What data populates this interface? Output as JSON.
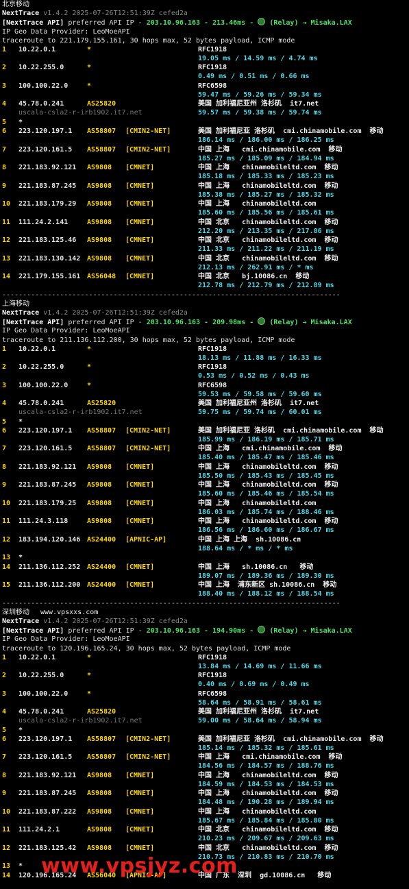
{
  "sections": [
    {
      "title": "北京移动",
      "site": "",
      "header": {
        "brand": "NextTrace",
        "version": "v1.4.2 2025-07-26T12:51:39Z cefed2a",
        "api_tag": "[NextTrace API]",
        "api_text": " preferred API IP - ",
        "api_ip": "203.10.96.163 - 213.46ms - ",
        "api_relay": " (Relay) → Misaka.LAX",
        "geo_provider": "IP Geo Data Provider: LeoMoeAPI",
        "traceroute": "traceroute to 221.179.155.161, 30 hops max, 52 bytes payload, ICMP mode"
      },
      "hops": [
        {
          "num": "1",
          "ip": "10.22.0.1",
          "asn": "*",
          "net": "",
          "geo": "RFC1918",
          "host": "",
          "rtt": "19.05 ms / 14.59 ms / 4.74 ms"
        },
        {
          "num": "2",
          "ip": "10.22.255.0",
          "asn": "*",
          "net": "",
          "geo": "RFC1918",
          "host": "",
          "rtt": "0.49 ms / 0.51 ms / 0.66 ms"
        },
        {
          "num": "3",
          "ip": "100.100.22.0",
          "asn": "*",
          "net": "",
          "geo": "RFC6598",
          "host": "",
          "rtt": "59.47 ms / 59.26 ms / 59.34 ms"
        },
        {
          "num": "4",
          "ip": "45.78.0.241",
          "asn": "AS25820",
          "net": "",
          "geo": "美国 加利福尼亚州 洛杉矶  it7.net",
          "host": "uscala-csla2-r-irb1902.it7.net",
          "rtt": "59.57 ms / 59.38 ms / 59.74 ms"
        },
        {
          "num": "5",
          "ip": "*",
          "asn": "",
          "net": "",
          "geo": "",
          "host": "",
          "rtt": "",
          "star": true
        },
        {
          "num": "6",
          "ip": "223.120.197.1",
          "asn": "AS58807",
          "net": "[CMIN2-NET]",
          "geo": "美国 加利福尼亚 洛杉矶  cmi.chinamobile.com  移动",
          "host": "",
          "rtt": "186.14 ms / 186.00 ms / 186.25 ms"
        },
        {
          "num": "7",
          "ip": "223.120.161.5",
          "asn": "AS58807",
          "net": "[CMIN2-NET]",
          "geo": "中国 上海   cmi.chinamobile.com  移动",
          "host": "",
          "rtt": "185.27 ms / 185.09 ms / 184.94 ms"
        },
        {
          "num": "8",
          "ip": "221.183.92.121",
          "asn": "AS9808",
          "net": "[CMNET]",
          "geo": "中国 上海   chinamobileltd.com  移动",
          "host": "",
          "rtt": "185.18 ms / 185.33 ms / 185.23 ms"
        },
        {
          "num": "9",
          "ip": "221.183.87.245",
          "asn": "AS9808",
          "net": "[CMNET]",
          "geo": "中国 上海   chinamobileltd.com  移动",
          "host": "",
          "rtt": "185.38 ms / 185.27 ms / 185.32 ms"
        },
        {
          "num": "10",
          "ip": "221.183.179.29",
          "asn": "AS9808",
          "net": "[CMNET]",
          "geo": "中国 上海   chinamobileltd.com",
          "host": "",
          "rtt": "185.60 ms / 185.56 ms / 185.61 ms"
        },
        {
          "num": "11",
          "ip": "111.24.2.141",
          "asn": "AS9808",
          "net": "[CMNET]",
          "geo": "中国 北京   chinamobileltd.com  移动",
          "host": "",
          "rtt": "212.20 ms / 213.35 ms / 217.86 ms"
        },
        {
          "num": "12",
          "ip": "221.183.125.46",
          "asn": "AS9808",
          "net": "[CMNET]",
          "geo": "中国 北京   chinamobileltd.com  移动",
          "host": "",
          "rtt": "211.33 ms / 211.22 ms / 211.19 ms"
        },
        {
          "num": "13",
          "ip": "221.183.130.142",
          "asn": "AS9808",
          "net": "[CMNET]",
          "geo": "中国 北京   chinamobileltd.com  移动",
          "host": "",
          "rtt": "212.13 ms / 262.91 ms / * ms"
        },
        {
          "num": "14",
          "ip": "221.179.155.161",
          "asn": "AS56048",
          "net": "[CMNET]",
          "geo": "中国 北京   bj.10086.cn  移动",
          "host": "",
          "rtt": "212.78 ms / 212.79 ms / 212.89 ms"
        }
      ]
    },
    {
      "title": "上海移动",
      "site": "",
      "header": {
        "brand": "NextTrace",
        "version": "v1.4.2 2025-07-26T12:51:39Z cefed2a",
        "api_tag": "[NextTrace API]",
        "api_text": " preferred API IP - ",
        "api_ip": "203.10.96.163 - 209.98ms - ",
        "api_relay": " (Relay) → Misaka.LAX",
        "geo_provider": "IP Geo Data Provider: LeoMoeAPI",
        "traceroute": "traceroute to 211.136.112.200, 30 hops max, 52 bytes payload, ICMP mode"
      },
      "hops": [
        {
          "num": "1",
          "ip": "10.22.0.1",
          "asn": "*",
          "net": "",
          "geo": "RFC1918",
          "host": "",
          "rtt": "18.13 ms / 11.88 ms / 16.33 ms"
        },
        {
          "num": "2",
          "ip": "10.22.255.0",
          "asn": "*",
          "net": "",
          "geo": "RFC1918",
          "host": "",
          "rtt": "0.53 ms / 0.52 ms / 0.43 ms"
        },
        {
          "num": "3",
          "ip": "100.100.22.0",
          "asn": "*",
          "net": "",
          "geo": "RFC6598",
          "host": "",
          "rtt": "59.53 ms / 59.58 ms / 59.60 ms"
        },
        {
          "num": "4",
          "ip": "45.78.0.241",
          "asn": "AS25820",
          "net": "",
          "geo": "美国 加利福尼亚州 洛杉矶  it7.net",
          "host": "uscala-csla2-r-irb1902.it7.net",
          "rtt": "59.75 ms / 59.74 ms / 60.01 ms"
        },
        {
          "num": "5",
          "ip": "*",
          "asn": "",
          "net": "",
          "geo": "",
          "host": "",
          "rtt": "",
          "star": true
        },
        {
          "num": "6",
          "ip": "223.120.197.1",
          "asn": "AS58807",
          "net": "[CMIN2-NET]",
          "geo": "美国 加利福尼亚 洛杉矶  cmi.chinamobile.com  移动",
          "host": "",
          "rtt": "185.99 ms / 186.19 ms / 185.71 ms"
        },
        {
          "num": "7",
          "ip": "223.120.161.5",
          "asn": "AS58807",
          "net": "[CMIN2-NET]",
          "geo": "中国 上海   cmi.chinamobile.com  移动",
          "host": "",
          "rtt": "185.40 ms / 185.47 ms / 185.46 ms"
        },
        {
          "num": "8",
          "ip": "221.183.92.121",
          "asn": "AS9808",
          "net": "[CMNET]",
          "geo": "中国 上海   chinamobileltd.com  移动",
          "host": "",
          "rtt": "185.50 ms / 185.43 ms / 185.45 ms"
        },
        {
          "num": "9",
          "ip": "221.183.87.245",
          "asn": "AS9808",
          "net": "[CMNET]",
          "geo": "中国 上海   chinamobileltd.com  移动",
          "host": "",
          "rtt": "185.60 ms / 185.46 ms / 185.54 ms"
        },
        {
          "num": "10",
          "ip": "221.183.179.25",
          "asn": "AS9808",
          "net": "[CMNET]",
          "geo": "中国 上海   chinamobileltd.com",
          "host": "",
          "rtt": "186.03 ms / 185.74 ms / 188.46 ms"
        },
        {
          "num": "11",
          "ip": "111.24.3.118",
          "asn": "AS9808",
          "net": "[CMNET]",
          "geo": "中国 上海   chinamobileltd.com  移动",
          "host": "",
          "rtt": "186.56 ms / 186.60 ms / 186.67 ms"
        },
        {
          "num": "12",
          "ip": "183.194.120.146",
          "asn": "AS24400",
          "net": "[APNIC-AP]",
          "geo": "中国 上海 上海  sh.10086.cn",
          "host": "",
          "rtt": "188.64 ms / * ms / * ms"
        },
        {
          "num": "13",
          "ip": "*",
          "asn": "",
          "net": "",
          "geo": "",
          "host": "",
          "rtt": "",
          "star": true
        },
        {
          "num": "14",
          "ip": "211.136.112.252",
          "asn": "AS24400",
          "net": "[CMNET]",
          "geo": "中国 上海   sh.10086.cn   移动",
          "host": "",
          "rtt": "189.07 ms / 189.36 ms / 189.30 ms"
        },
        {
          "num": "15",
          "ip": "211.136.112.200",
          "asn": "AS24400",
          "net": "[CMNET]",
          "geo": "中国 上海  浦东新区 sh.10086.cn  移动",
          "host": "",
          "rtt": "188.40 ms / 188.12 ms / 188.54 ms"
        }
      ]
    },
    {
      "title": "深圳移动",
      "site": "www.vpsxxs.com",
      "header": {
        "brand": "NextTrace",
        "version": "v1.4.2 2025-07-26T12:51:39Z cefed2a",
        "api_tag": "[NextTrace API]",
        "api_text": " preferred API IP - ",
        "api_ip": "203.10.96.163 - 194.90ms - ",
        "api_relay": " (Relay) → Misaka.LAX",
        "geo_provider": "IP Geo Data Provider: LeoMoeAPI",
        "traceroute": "traceroute to 120.196.165.24, 30 hops max, 52 bytes payload, ICMP mode"
      },
      "hops": [
        {
          "num": "1",
          "ip": "10.22.0.1",
          "asn": "*",
          "net": "",
          "geo": "RFC1918",
          "host": "",
          "rtt": "13.84 ms / 14.69 ms / 11.66 ms"
        },
        {
          "num": "2",
          "ip": "10.22.255.0",
          "asn": "*",
          "net": "",
          "geo": "RFC1918",
          "host": "",
          "rtt": "0.40 ms / 0.69 ms / 0.49 ms"
        },
        {
          "num": "3",
          "ip": "100.100.22.0",
          "asn": "*",
          "net": "",
          "geo": "RFC6598",
          "host": "",
          "rtt": "58.64 ms / 58.91 ms / 58.61 ms"
        },
        {
          "num": "4",
          "ip": "45.78.0.241",
          "asn": "AS25820",
          "net": "",
          "geo": "美国 加利福尼亚州 洛杉矶  it7.net",
          "host": "uscala-csla2-r-irb1902.it7.net",
          "rtt": "59.00 ms / 58.64 ms / 58.94 ms"
        },
        {
          "num": "5",
          "ip": "*",
          "asn": "",
          "net": "",
          "geo": "",
          "host": "",
          "rtt": "",
          "star": true
        },
        {
          "num": "6",
          "ip": "223.120.197.1",
          "asn": "AS58807",
          "net": "[CMIN2-NET]",
          "geo": "美国 加利福尼亚 洛杉矶  cmi.chinamobile.com  移动",
          "host": "",
          "rtt": "185.14 ms / 185.32 ms / 185.61 ms"
        },
        {
          "num": "7",
          "ip": "223.120.161.5",
          "asn": "AS58807",
          "net": "[CMIN2-NET]",
          "geo": "中国 上海   cmi.chinamobile.com  移动",
          "host": "",
          "rtt": "184.56 ms / 184.57 ms / 188.76 ms"
        },
        {
          "num": "8",
          "ip": "221.183.92.121",
          "asn": "AS9808",
          "net": "[CMNET]",
          "geo": "中国 上海   chinamobileltd.com  移动",
          "host": "",
          "rtt": "184.59 ms / 184.53 ms / 184.53 ms"
        },
        {
          "num": "9",
          "ip": "221.183.87.245",
          "asn": "AS9808",
          "net": "[CMNET]",
          "geo": "中国 上海   chinamobileltd.com  移动",
          "host": "",
          "rtt": "184.48 ms / 190.28 ms / 189.94 ms"
        },
        {
          "num": "10",
          "ip": "221.183.87.222",
          "asn": "AS9808",
          "net": "[CMNET]",
          "geo": "中国 上海   chinamobileltd.com",
          "host": "",
          "rtt": "185.67 ms / 185.84 ms / 185.80 ms"
        },
        {
          "num": "11",
          "ip": "111.24.2.1",
          "asn": "AS9808",
          "net": "[CMNET]",
          "geo": "中国 北京   chinamobileltd.com  移动",
          "host": "",
          "rtt": "210.23 ms / 209.67 ms / 209.63 ms"
        },
        {
          "num": "12",
          "ip": "221.183.125.42",
          "asn": "AS9808",
          "net": "[CMNET]",
          "geo": "中国 北京   chinamobileltd.com  移动",
          "host": "",
          "rtt": "210.73 ms / 210.83 ms / 210.70 ms"
        },
        {
          "num": "13",
          "ip": "*",
          "asn": "",
          "net": "",
          "geo": "",
          "host": "",
          "rtt": "",
          "star": true
        },
        {
          "num": "14",
          "ip": "120.196.165.24",
          "asn": "AS56040",
          "net": "[APNIC-AP]",
          "geo": "中国 广东  深圳  gd.10086.cn   移动",
          "host": "",
          "rtt": ""
        }
      ]
    }
  ],
  "separator": "----------------------------------------------------------------------------------",
  "watermark": "www.vpsjyz.com",
  "colors": {
    "background": "#000000",
    "hop_number": "#ffd700",
    "asn": "#ffd700",
    "rtt": "#4fd8e8",
    "api_ip": "#4fe36a",
    "hostname": "#777777",
    "watermark": "#e4201c"
  }
}
